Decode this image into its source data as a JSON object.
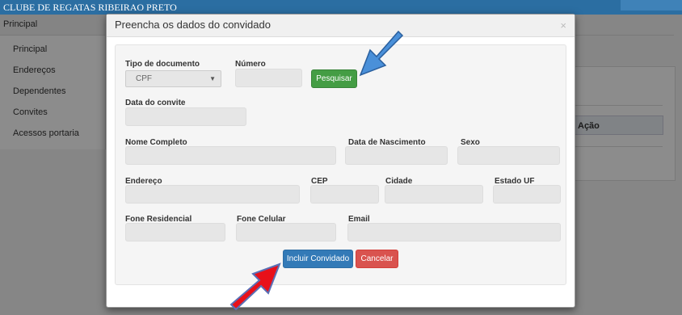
{
  "app": {
    "title": "CLUBE DE REGATAS RIBEIRAO PRETO"
  },
  "sidebar": {
    "header": "Principal",
    "items": [
      {
        "label": "Principal"
      },
      {
        "label": "Endereços"
      },
      {
        "label": "Dependentes"
      },
      {
        "label": "Convites"
      },
      {
        "label": "Acessos portaria"
      }
    ]
  },
  "background": {
    "action_header": "Ação"
  },
  "modal": {
    "title": "Preencha os dados do convidado",
    "close": "×",
    "fields": {
      "tipo_documento": {
        "label": "Tipo de documento",
        "value": "CPF"
      },
      "numero": {
        "label": "Número",
        "value": ""
      },
      "data_convite": {
        "label": "Data do convite",
        "value": ""
      },
      "nome_completo": {
        "label": "Nome Completo",
        "value": ""
      },
      "data_nascimento": {
        "label": "Data de Nascimento",
        "value": ""
      },
      "sexo": {
        "label": "Sexo",
        "value": ""
      },
      "endereco": {
        "label": "Endereço",
        "value": ""
      },
      "cep": {
        "label": "CEP",
        "value": ""
      },
      "cidade": {
        "label": "Cidade",
        "value": ""
      },
      "estado_uf": {
        "label": "Estado UF",
        "value": ""
      },
      "fone_residencial": {
        "label": "Fone Residencial",
        "value": ""
      },
      "fone_celular": {
        "label": "Fone Celular",
        "value": ""
      },
      "email": {
        "label": "Email",
        "value": ""
      }
    },
    "buttons": {
      "pesquisar": "Pesquisar",
      "incluir": "Incluir Convidado",
      "cancelar": "Cancelar"
    }
  },
  "colors": {
    "topbar": "#2b6ea2",
    "btn_green": "#449d44",
    "btn_blue": "#337ab7",
    "btn_red": "#d9534f",
    "arrow_blue": "#4a90d9",
    "arrow_red": "#e8101a"
  },
  "annotations": [
    {
      "icon": "blue-arrow-icon",
      "target": "pesquisar"
    },
    {
      "icon": "red-arrow-icon",
      "target": "incluir"
    }
  ]
}
